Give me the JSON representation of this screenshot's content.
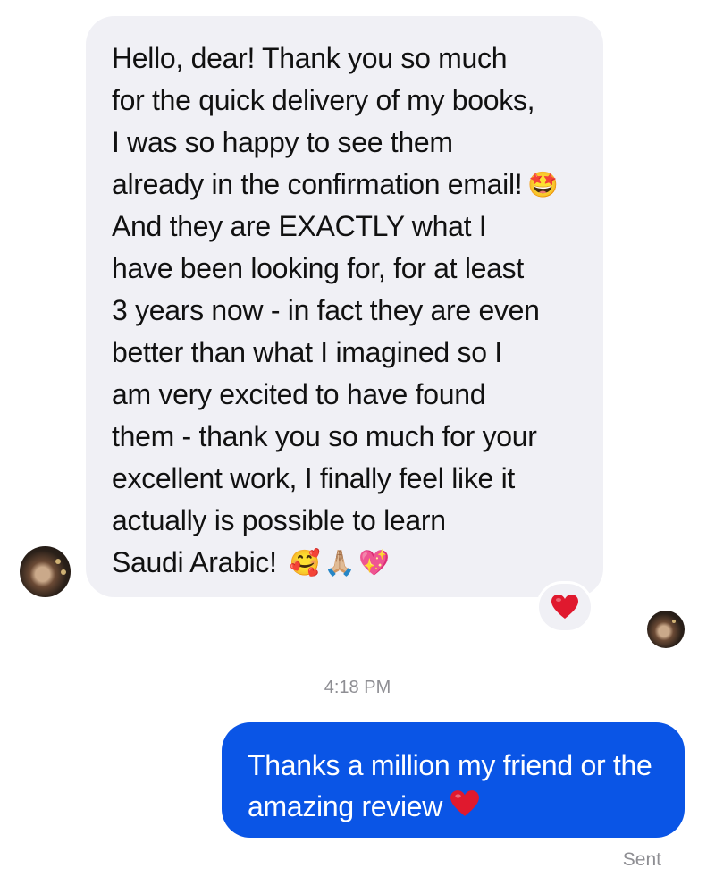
{
  "conversation": {
    "incoming": {
      "lines": [
        "Hello, dear! Thank you so much",
        "for the quick delivery of my books,",
        "I was so happy to see them",
        "already in the confirmation email!",
        "And they are EXACTLY what I",
        "have been looking for, for at least",
        "3 years now - in fact they are even",
        "better than what I imagined so I",
        "am very excited to have found",
        "them - thank you so much for your",
        "excellent work, I finally feel like it",
        "actually is possible to learn",
        "Saudi Arabic!"
      ],
      "emoji_after_line_4": "🤩",
      "emoji_after_last_line": "🥰🙏🏼💖",
      "reaction_icon": "red-heart-icon"
    },
    "timestamp": "4:18 PM",
    "outgoing": {
      "lines": [
        "Thanks a million my friend or the",
        "amazing review"
      ],
      "trailing_icon": "red-heart-icon"
    },
    "status": "Sent"
  },
  "colors": {
    "incoming_bubble": "#f0f0f5",
    "outgoing_bubble": "#0a55e6",
    "heart": "#e0192e",
    "meta_text": "#8e8e93"
  }
}
